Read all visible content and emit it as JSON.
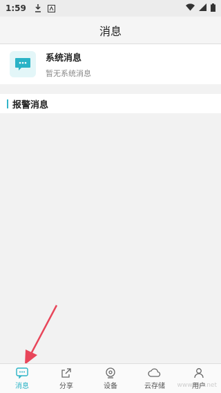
{
  "status_bar": {
    "time": "1:59"
  },
  "header": {
    "title": "消息"
  },
  "system_message": {
    "title": "系统消息",
    "subtitle": "暂无系统消息"
  },
  "alarm": {
    "label": "报警消息"
  },
  "tabs": [
    {
      "label": "消息",
      "icon": "chat-icon",
      "active": true
    },
    {
      "label": "分享",
      "icon": "share-icon",
      "active": false
    },
    {
      "label": "设备",
      "icon": "device-icon",
      "active": false
    },
    {
      "label": "云存储",
      "icon": "cloud-icon",
      "active": false
    },
    {
      "label": "用户",
      "icon": "user-icon",
      "active": false
    }
  ],
  "colors": {
    "accent": "#2ab3c6",
    "arrow": "#e8465a"
  },
  "watermark": "www.kkx.net"
}
